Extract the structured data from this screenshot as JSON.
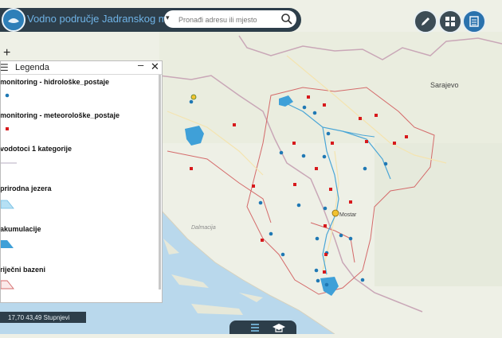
{
  "app": {
    "title": "Vodno područje Jadranskog mora"
  },
  "search": {
    "placeholder": "Pronađi adresu ili mjesto"
  },
  "legend": {
    "title": "Legenda",
    "items": [
      {
        "label": "monitoring - hidrološke_postaje"
      },
      {
        "label": "monitoring - meteorološke_postaje"
      },
      {
        "label": "vodotoci 1 kategorije"
      },
      {
        "label": "prirodna jezera"
      },
      {
        "label": "akumulacije"
      },
      {
        "label": "riječni bazeni"
      }
    ]
  },
  "map": {
    "city_label": "Sarajevo",
    "mostar_label": "Mostar",
    "region_label": "Dalmacija"
  },
  "status": {
    "coordinates": "17,70 43,49 Stupnjevi"
  },
  "colors": {
    "topbar": "#2d3e4a",
    "accent": "#2a72ad",
    "hydro": "#1f78b4",
    "meteo": "#d7191c"
  }
}
